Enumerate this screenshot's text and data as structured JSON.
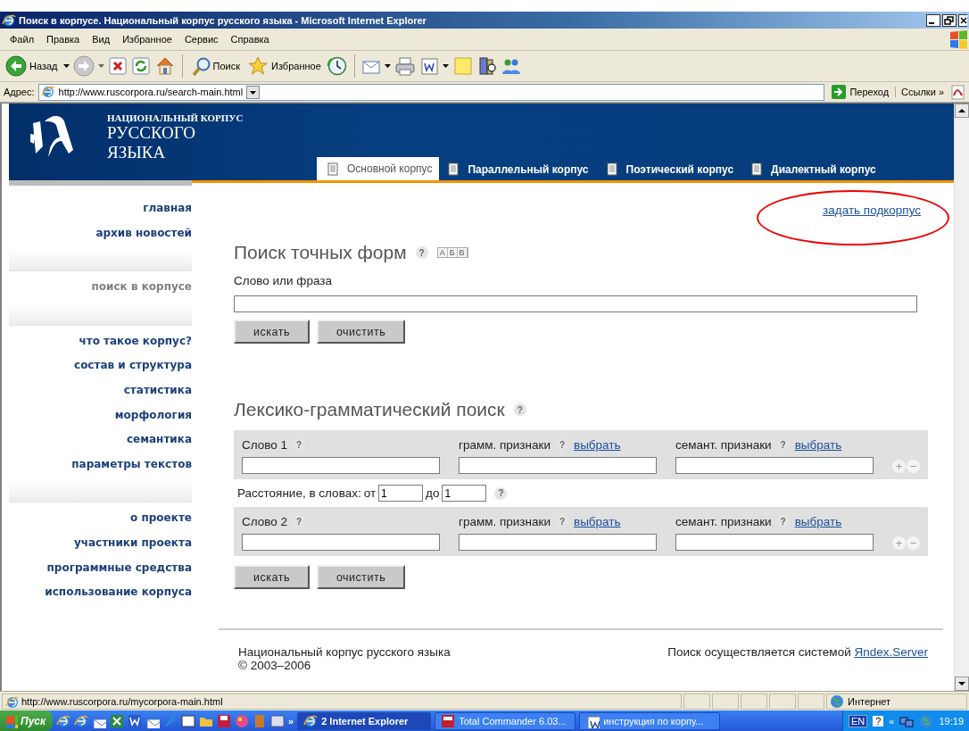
{
  "window": {
    "title": "Поиск в корпусе. Национальный корпус русского языка - Microsoft Internet Explorer"
  },
  "menu": [
    "Файл",
    "Правка",
    "Вид",
    "Избранное",
    "Сервис",
    "Справка"
  ],
  "toolbar": {
    "back": "Назад",
    "search": "Поиск",
    "favorites": "Избранное"
  },
  "address_bar": {
    "label": "Адрес:",
    "url": "http://www.ruscorpora.ru/search-main.html",
    "go": "Переход",
    "links": "Ссылки",
    "more": "»"
  },
  "site": {
    "logo_lines": [
      "НАЦИОНАЛЬНЫЙ КОРПУС",
      "РУССКОГО",
      "ЯЗЫКА"
    ],
    "tabs": [
      {
        "label": "Основной корпус",
        "selected": true
      },
      {
        "label": "Параллельный корпус",
        "selected": false
      },
      {
        "label": "Поэтический корпус",
        "selected": false
      },
      {
        "label": "Диалектный корпус",
        "selected": false
      }
    ],
    "sidebar": {
      "groups": [
        {
          "items": [
            {
              "label": "главная",
              "selected": false
            },
            {
              "label": "архив новостей",
              "selected": false
            }
          ]
        },
        {
          "items": [
            {
              "label": "поиск в корпусе",
              "selected": true
            }
          ]
        },
        {
          "items": [
            {
              "label": "что такое корпус?",
              "selected": false
            },
            {
              "label": "состав и структура",
              "selected": false
            },
            {
              "label": "статистика",
              "selected": false
            },
            {
              "label": "морфология",
              "selected": false
            },
            {
              "label": "семантика",
              "selected": false
            },
            {
              "label": "параметры текстов",
              "selected": false
            }
          ]
        },
        {
          "items": [
            {
              "label": "о проекте",
              "selected": false
            },
            {
              "label": "участники проекта",
              "selected": false
            },
            {
              "label": "программные средства",
              "selected": false
            },
            {
              "label": "использование корпуса",
              "selected": false
            }
          ]
        }
      ]
    },
    "subcorpus_link": "задать подкорпус",
    "exact_search": {
      "title": "Поиск точных форм",
      "help": "?",
      "keyboard_keys": [
        "А",
        "Б",
        "В"
      ],
      "field_label": "Слово или фраза",
      "buttons": [
        "искать",
        "очистить"
      ]
    },
    "lexgram_search": {
      "title": "Лексико-грамматический поиск",
      "help": "?",
      "words": [
        {
          "label": "Слово 1",
          "help": "?",
          "gram_label": "грамм. признаки",
          "gram_help": "?",
          "gram_link": "выбрать",
          "sem_label": "семант. признаки",
          "sem_help": "?",
          "sem_link": "выбрать",
          "add": "+",
          "remove": "−"
        },
        {
          "label": "Слово 2",
          "help": "?",
          "gram_label": "грамм. признаки",
          "gram_help": "?",
          "gram_link": "выбрать",
          "sem_label": "семант. признаки",
          "sem_help": "?",
          "sem_link": "выбрать",
          "add": "+",
          "remove": "−"
        }
      ],
      "distance": {
        "label": "Расстояние, в словах:",
        "from_label": "от",
        "from_value": "1",
        "to_label": "до",
        "to_value": "1",
        "help": "?"
      },
      "buttons": [
        "искать",
        "очистить"
      ]
    },
    "footer": {
      "left_lines": [
        "Национальный корпус русского языка",
        "© 2003–2006"
      ],
      "right_text": "Поиск осуществляется системой",
      "right_link": "Яndex.Server"
    }
  },
  "status_bar": {
    "url": "http://www.ruscorpora.ru/mycorpora-main.html",
    "zone": "Интернет"
  },
  "taskbar": {
    "start": "Пуск",
    "more": "»",
    "tasks": [
      {
        "label": "2 Internet Explorer",
        "selected": true
      },
      {
        "label": "Total Commander 6.03...",
        "selected": false
      },
      {
        "label": "инструкция по корпу...",
        "selected": false
      }
    ],
    "language": "EN",
    "help": "?",
    "tray_more": "«",
    "clock": "19:19"
  }
}
